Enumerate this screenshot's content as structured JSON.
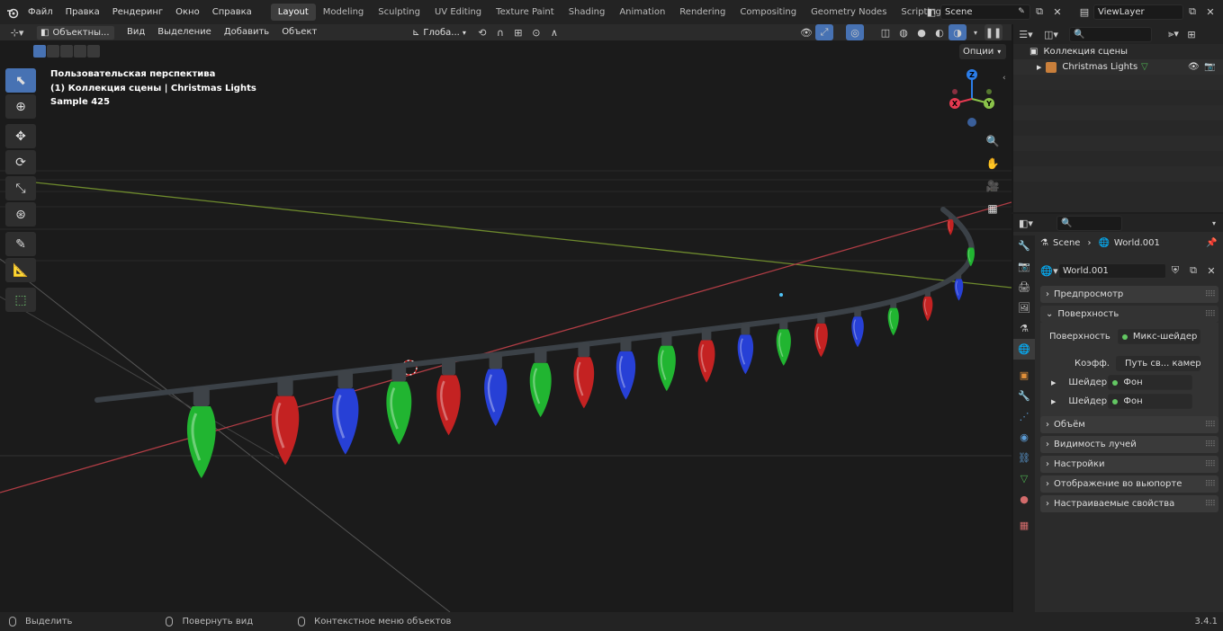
{
  "topbar": {
    "menus": [
      "Файл",
      "Правка",
      "Рендеринг",
      "Окно",
      "Справка"
    ],
    "workspaces": [
      "Layout",
      "Modeling",
      "Sculpting",
      "UV Editing",
      "Texture Paint",
      "Shading",
      "Animation",
      "Rendering",
      "Compositing",
      "Geometry Nodes",
      "Scripting"
    ],
    "active_workspace": "Layout",
    "add_tab": "+",
    "scene": "Scene",
    "view_layer": "ViewLayer"
  },
  "viewport_header": {
    "mode": "Объектны...",
    "menus": [
      "Вид",
      "Выделение",
      "Добавить",
      "Объект"
    ],
    "orientation": "Глоба...",
    "options": "Опции"
  },
  "viewport": {
    "perspective": "Пользовательская перспектива",
    "collection": "(1) Коллекция сцены | Christmas Lights",
    "sample": "Sample 425",
    "gizmo": {
      "z": "Z",
      "y": "Y",
      "x": "X"
    },
    "bulb_colors": [
      "#21b531",
      "#c42222",
      "#2740d6"
    ]
  },
  "outliner": {
    "root": "Коллекция сцены",
    "item": "Christmas Lights"
  },
  "properties": {
    "breadcrumb_scene": "Scene",
    "breadcrumb_world": "World.001",
    "world_name": "World.001",
    "panels": {
      "preview": "Предпросмотр",
      "surface": "Поверхность",
      "volume": "Объём",
      "ray_visibility": "Видимость лучей",
      "settings": "Настройки",
      "viewport_display": "Отображение во вьюпорте",
      "custom_props": "Настраиваемые свойства"
    },
    "surface_label": "Поверхность",
    "surface_value": "Микс-шейдер",
    "fac_label": "Коэфф.",
    "fac_value": "Путь св... камеры",
    "shader1_label": "Шейдер",
    "shader1_value": "Фон",
    "shader2_label": "Шейдер",
    "shader2_value": "Фон"
  },
  "status": {
    "select": "Выделить",
    "rotate": "Повернуть вид",
    "context": "Контекстное меню объектов",
    "version": "3.4.1"
  },
  "colors": {
    "accent": "#4772b3",
    "active_tab": "#e07b39"
  }
}
